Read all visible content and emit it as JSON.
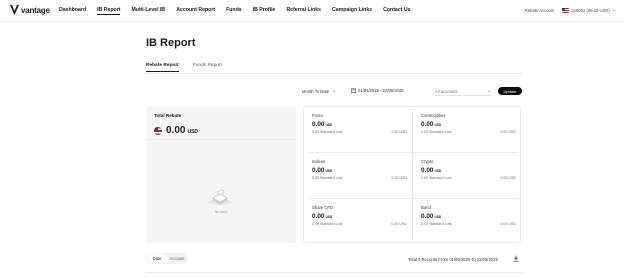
{
  "brand": {
    "logo_text": "vantage"
  },
  "nav": {
    "items": [
      {
        "label": "Dashboard"
      },
      {
        "label": "IB Report"
      },
      {
        "label": "Multi-Level IB"
      },
      {
        "label": "Account Report"
      },
      {
        "label": "Funds"
      },
      {
        "label": "IB Profile"
      },
      {
        "label": "Referral Links"
      },
      {
        "label": "Campaign Links"
      },
      {
        "label": "Contact Us"
      }
    ],
    "active_index": 1
  },
  "header_right": {
    "rebate_account_label": "Rebate Account",
    "account_value": "216002 (69.10 USD)"
  },
  "page": {
    "title": "IB Report"
  },
  "tabs": [
    {
      "label": "Rebate Report"
    },
    {
      "label": "Funds Report"
    }
  ],
  "filters": {
    "period": "Month To Date",
    "date_range": "01/05/2025 - 22/05/2025",
    "accounts_placeholder": "All accounts",
    "update_label": "Update"
  },
  "rebate": {
    "label": "Total Rebate",
    "amount": "0.00",
    "currency": "USD",
    "no_data": "No data"
  },
  "products": [
    {
      "name": "Forex",
      "amount": "0.00",
      "unit": "USD",
      "lots": "0.00 Standard Lots",
      "usd": "0.00 USD"
    },
    {
      "name": "Commodities",
      "amount": "0.00",
      "unit": "USD",
      "lots": "0.00 Standard Lots",
      "usd": "0.00 USD"
    },
    {
      "name": "Indices",
      "amount": "0.00",
      "unit": "USD",
      "lots": "0.00 Standard Lots",
      "usd": "0.00 USD"
    },
    {
      "name": "Crypto",
      "amount": "0.00",
      "unit": "USD",
      "lots": "0.00 Standard Lots",
      "usd": "0.00 USD"
    },
    {
      "name": "Share CFD",
      "amount": "0.00",
      "unit": "USD",
      "lots": "0.00 Standard Lots",
      "usd": "0.00 USD"
    },
    {
      "name": "Bond",
      "amount": "0.00",
      "unit": "USD",
      "lots": "0.00 Standard Lots",
      "usd": "0.00 USD"
    }
  ],
  "bottom": {
    "segments": [
      {
        "label": "Date"
      },
      {
        "label": "Account"
      }
    ],
    "records_text": "Total 0 Records From 01/05/2025 To 22/05/2025"
  },
  "colors": {
    "accent": "#0d0d0d",
    "panel_bg": "#f5f5f5",
    "divider": "#ececec"
  },
  "icons": [
    "vantage-logo-icon",
    "us-flag-icon",
    "chevron-down-icon",
    "calendar-icon",
    "no-data-icon",
    "download-icon"
  ]
}
